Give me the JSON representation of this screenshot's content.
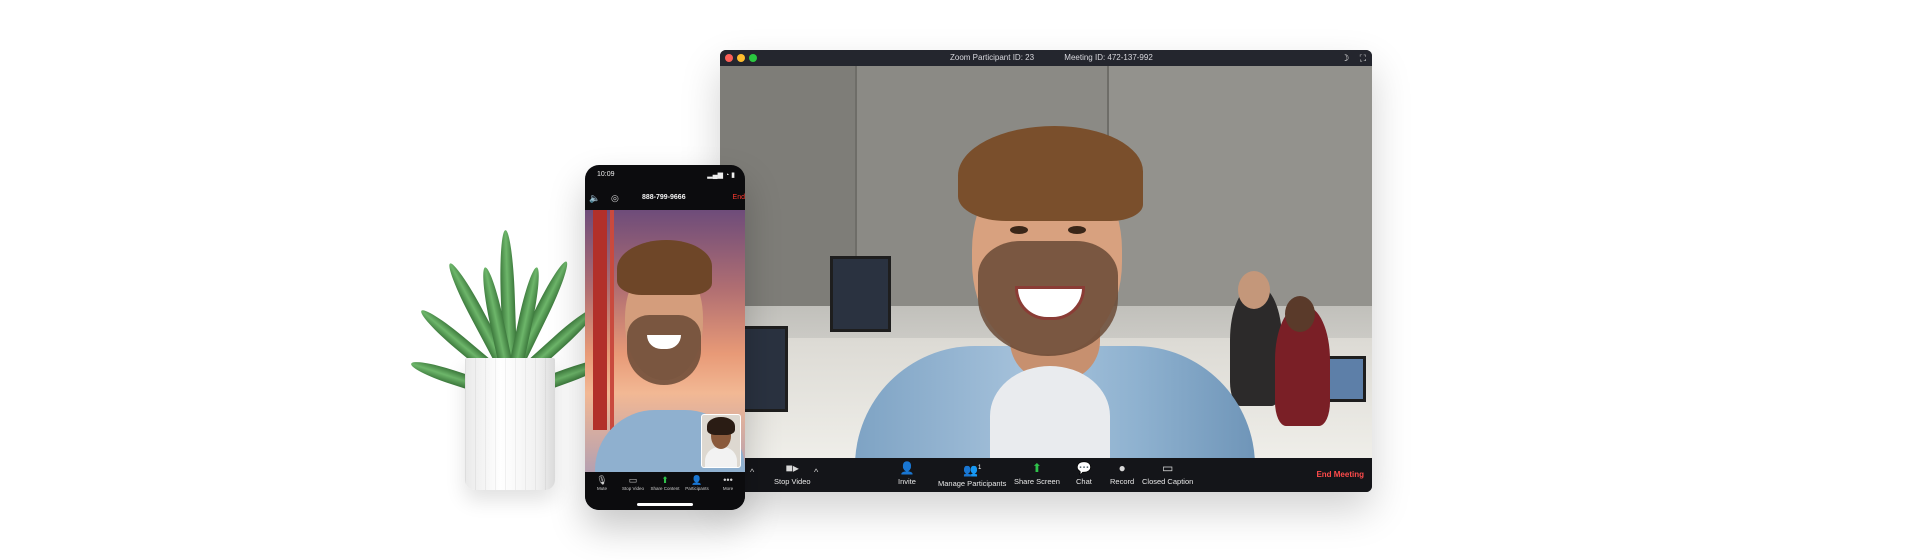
{
  "desktop": {
    "title": {
      "participant_id": "Zoom Participant ID: 23",
      "meeting_id": "Meeting ID: 472-137-992"
    },
    "toolbar": {
      "stop_video": "Stop Video",
      "invite": "Invite",
      "manage_participants": "Manage Participants",
      "participants_count": "1",
      "share_screen": "Share Screen",
      "chat": "Chat",
      "record": "Record",
      "closed_caption": "Closed Caption",
      "end_meeting": "End Meeting"
    },
    "colors": {
      "end_meeting": "#ff4b4b",
      "share_green": "#2fc14a"
    }
  },
  "phone": {
    "time": "10:09",
    "number": "888-799-9666",
    "end": "End",
    "toolbar": {
      "mute": "Mute",
      "stop_video": "Stop Video",
      "share_content": "Share Content",
      "participants": "Participants",
      "more": "More"
    }
  }
}
